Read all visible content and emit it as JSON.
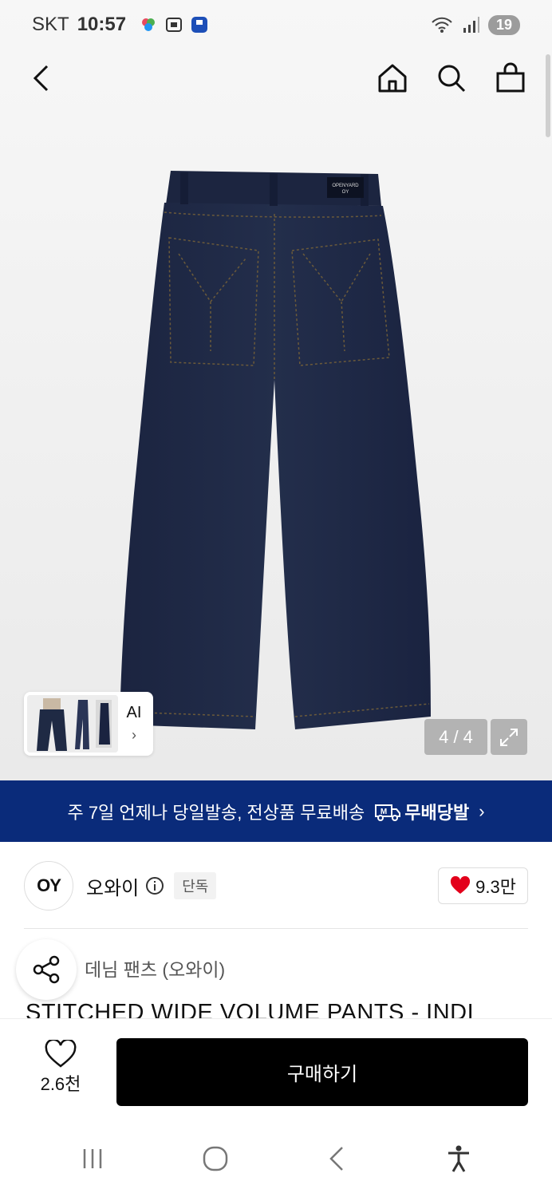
{
  "status_bar": {
    "carrier": "SKT",
    "time": "10:57",
    "battery": "19"
  },
  "gallery": {
    "counter": "4 / 4",
    "ai_label": "AI",
    "label_text": "OPENYARD\nOY"
  },
  "shipping_banner": {
    "text": "주 7일 언제나 당일발송, 전상품 무료배송",
    "badge": "무배당발"
  },
  "brand": {
    "logo_text": "OY",
    "name": "오와이",
    "badge": "단독",
    "likes": "9.3만"
  },
  "product": {
    "category": "데님 팬츠 (오와이)",
    "title": "STITCHED WIDE VOLUME PANTS - INDI"
  },
  "purchase_bar": {
    "wish_count": "2.6천",
    "buy_label": "구매하기"
  },
  "colors": {
    "banner": "#0a2b7a",
    "heart": "#e3001b",
    "denim": "#1f2a44",
    "buy_button": "#000000"
  }
}
